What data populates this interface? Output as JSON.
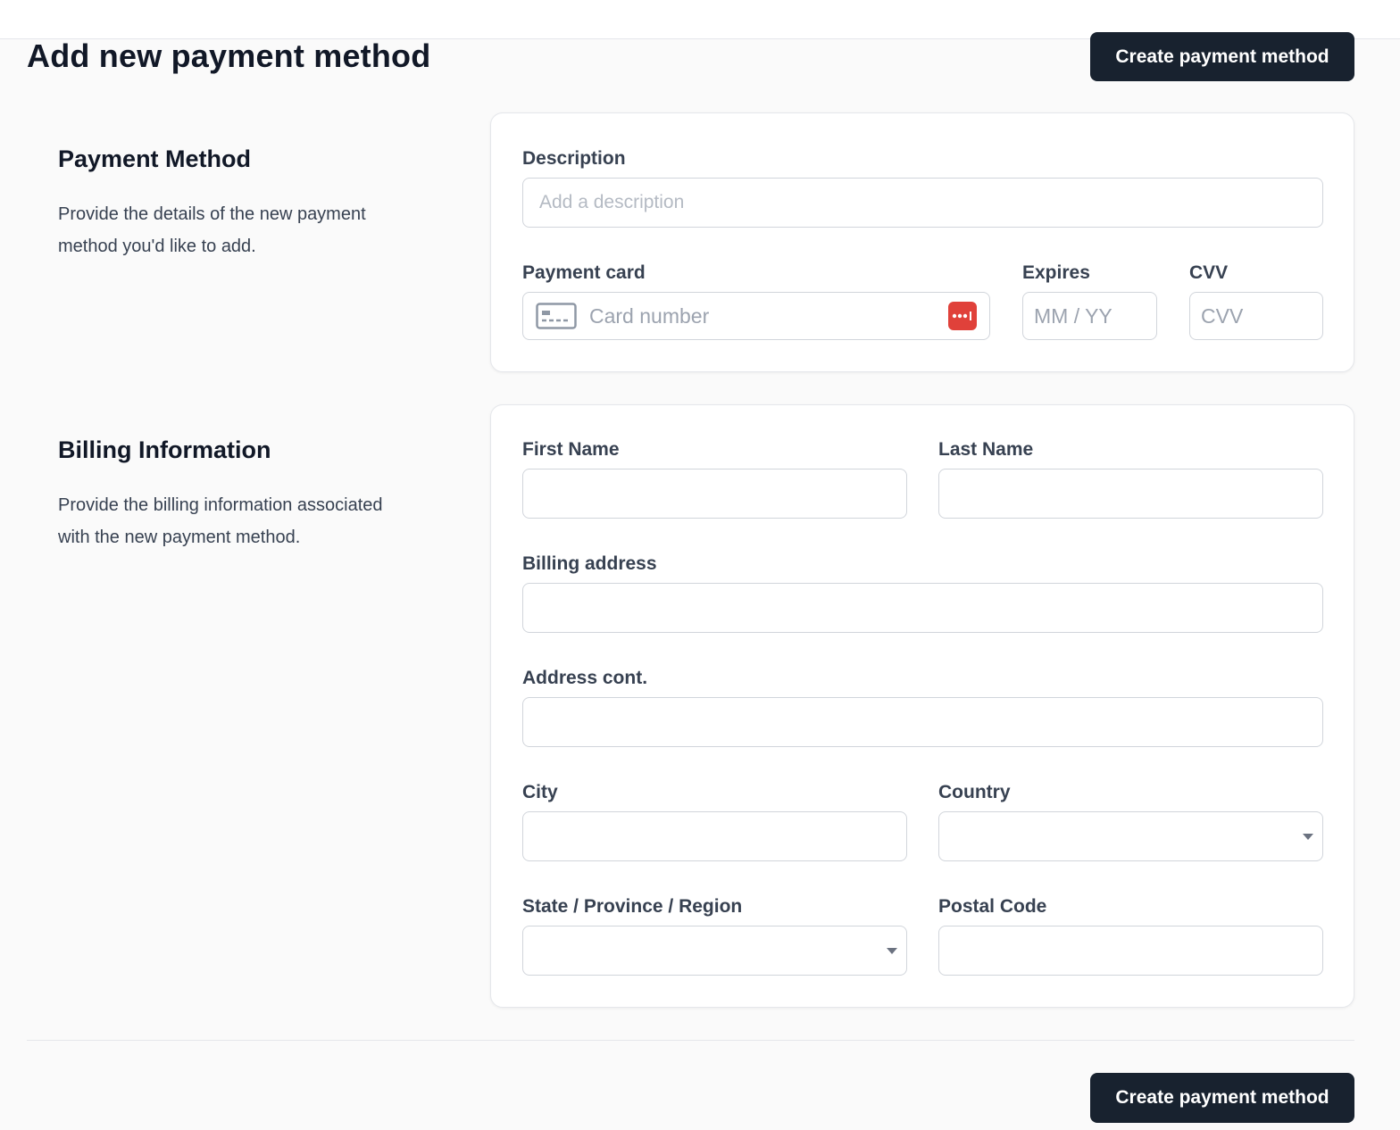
{
  "header": {
    "title": "Add new payment method",
    "primary_action": "Create payment method"
  },
  "payment_section": {
    "title": "Payment Method",
    "description": "Provide the details of the new payment method you'd like to add.",
    "description_label": "Description",
    "description_placeholder": "Add a description",
    "card_label": "Payment card",
    "card_placeholder": "Card number",
    "expires_label": "Expires",
    "expires_placeholder": "MM / YY",
    "cvv_label": "CVV",
    "cvv_placeholder": "CVV"
  },
  "billing_section": {
    "title": "Billing Information",
    "description": "Provide the billing information associated with the new payment method.",
    "first_name_label": "First Name",
    "last_name_label": "Last Name",
    "address_label": "Billing address",
    "address_cont_label": "Address cont.",
    "city_label": "City",
    "country_label": "Country",
    "state_label": "State / Province / Region",
    "postal_label": "Postal Code"
  },
  "footer": {
    "primary_action": "Create payment method"
  },
  "colors": {
    "primary_button": "#18222f",
    "password_manager_icon": "#e0413a",
    "background": "#fafafa"
  }
}
